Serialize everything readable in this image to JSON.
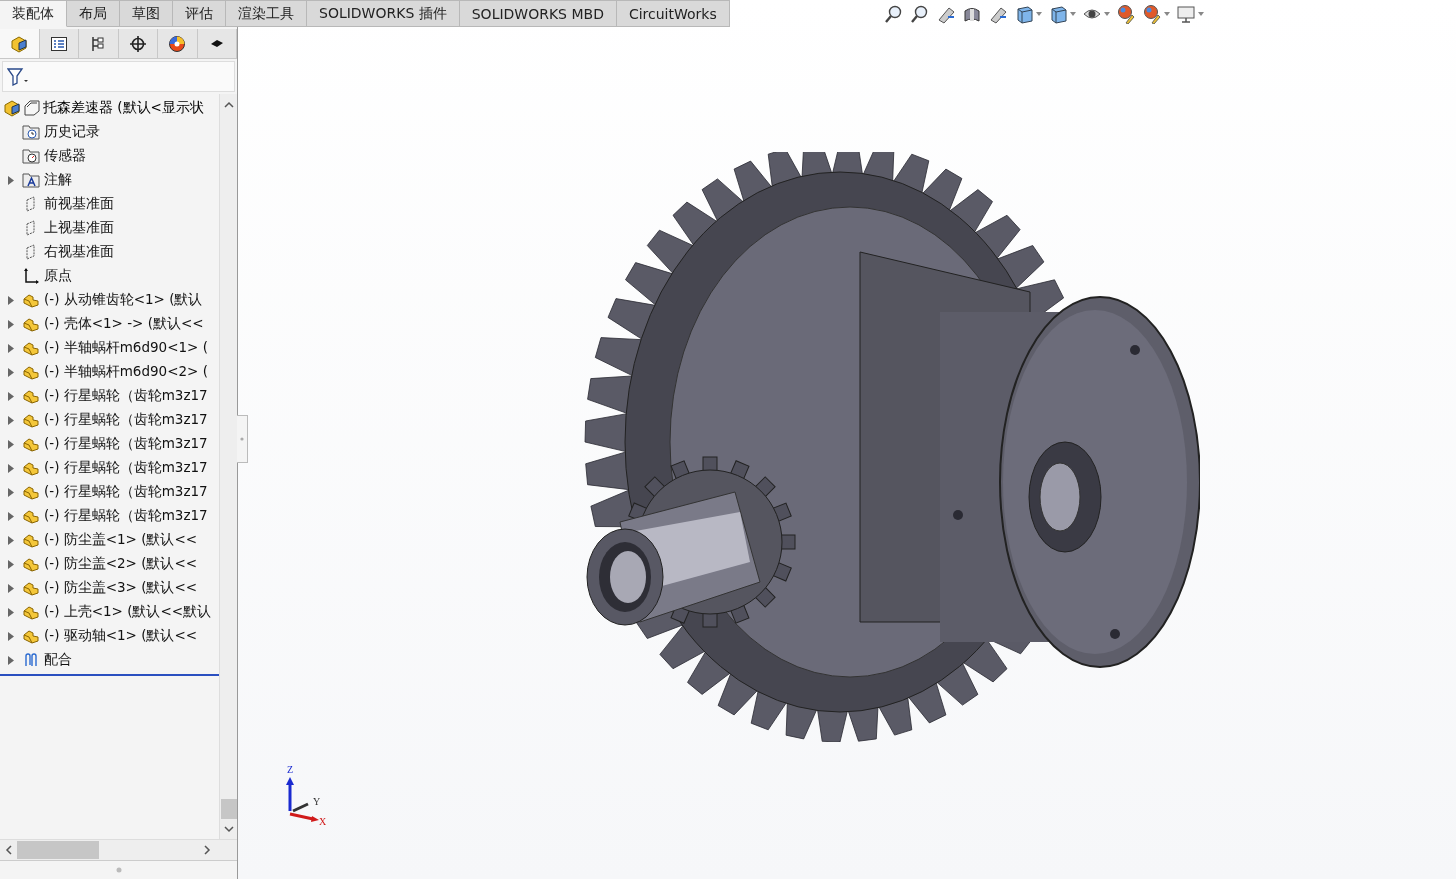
{
  "command_tabs": [
    {
      "label": "装配体",
      "selected": true
    },
    {
      "label": "布局",
      "selected": false
    },
    {
      "label": "草图",
      "selected": false
    },
    {
      "label": "评估",
      "selected": false
    },
    {
      "label": "渲染工具",
      "selected": false
    },
    {
      "label": "SOLIDWORKS 插件",
      "selected": false
    },
    {
      "label": "SOLIDWORKS MBD",
      "selected": false
    },
    {
      "label": "CircuitWorks",
      "selected": false
    }
  ],
  "panel_tabs": [
    {
      "kind": "feature-manager",
      "selected": true
    },
    {
      "kind": "property-manager",
      "selected": false
    },
    {
      "kind": "configuration-manager",
      "selected": false
    },
    {
      "kind": "dimxpert",
      "selected": false
    },
    {
      "kind": "display-manager",
      "selected": false
    },
    {
      "kind": "cam",
      "selected": false
    }
  ],
  "feature_tree": {
    "root": {
      "label": "托森差速器 (默认<显示状",
      "expanded": true
    },
    "items": [
      {
        "kind": "history",
        "label": "历史记录",
        "expandable": false
      },
      {
        "kind": "sensor",
        "label": "传感器",
        "expandable": false
      },
      {
        "kind": "annotation",
        "label": "注解",
        "expandable": true
      },
      {
        "kind": "plane",
        "label": "前视基准面",
        "expandable": false
      },
      {
        "kind": "plane",
        "label": "上视基准面",
        "expandable": false
      },
      {
        "kind": "plane",
        "label": "右视基准面",
        "expandable": false
      },
      {
        "kind": "origin",
        "label": "原点",
        "expandable": false
      },
      {
        "kind": "part",
        "label": "(-) 从动锥齿轮<1> (默认",
        "expandable": true
      },
      {
        "kind": "part",
        "label": "(-) 壳体<1> -> (默认<<",
        "expandable": true
      },
      {
        "kind": "part",
        "label": "(-) 半轴蜗杆m6d90<1> (",
        "expandable": true
      },
      {
        "kind": "part",
        "label": "(-) 半轴蜗杆m6d90<2> (",
        "expandable": true
      },
      {
        "kind": "part",
        "label": "(-) 行星蜗轮（齿轮m3z17",
        "expandable": true
      },
      {
        "kind": "part",
        "label": "(-) 行星蜗轮（齿轮m3z17",
        "expandable": true
      },
      {
        "kind": "part",
        "label": "(-) 行星蜗轮（齿轮m3z17",
        "expandable": true
      },
      {
        "kind": "part",
        "label": "(-) 行星蜗轮（齿轮m3z17",
        "expandable": true
      },
      {
        "kind": "part",
        "label": "(-) 行星蜗轮（齿轮m3z17",
        "expandable": true
      },
      {
        "kind": "part",
        "label": "(-) 行星蜗轮（齿轮m3z17",
        "expandable": true
      },
      {
        "kind": "part",
        "label": "(-) 防尘盖<1> (默认<<",
        "expandable": true
      },
      {
        "kind": "part",
        "label": "(-) 防尘盖<2> (默认<<",
        "expandable": true
      },
      {
        "kind": "part",
        "label": "(-) 防尘盖<3> (默认<<",
        "expandable": true
      },
      {
        "kind": "part",
        "label": "(-) 上壳<1> (默认<<默认",
        "expandable": true
      },
      {
        "kind": "part",
        "label": "(-) 驱动轴<1> (默认<<",
        "expandable": true
      },
      {
        "kind": "mates",
        "label": "配合",
        "expandable": true
      }
    ]
  },
  "view_toolbar": [
    {
      "kind": "zoom-fit",
      "dropdown": false
    },
    {
      "kind": "zoom-area",
      "dropdown": false
    },
    {
      "kind": "previous-view",
      "dropdown": false
    },
    {
      "kind": "section-view",
      "dropdown": false
    },
    {
      "kind": "dynamic-annotation",
      "dropdown": false
    },
    {
      "kind": "view-orientation",
      "dropdown": true
    },
    {
      "kind": "display-style",
      "dropdown": true
    },
    {
      "kind": "hide-show",
      "dropdown": true
    },
    {
      "kind": "edit-appearance",
      "dropdown": false
    },
    {
      "kind": "apply-scene",
      "dropdown": true
    },
    {
      "kind": "view-settings",
      "dropdown": true
    }
  ],
  "triad": {
    "z_label": "Z",
    "y_label": "Y",
    "x_label": "X"
  }
}
